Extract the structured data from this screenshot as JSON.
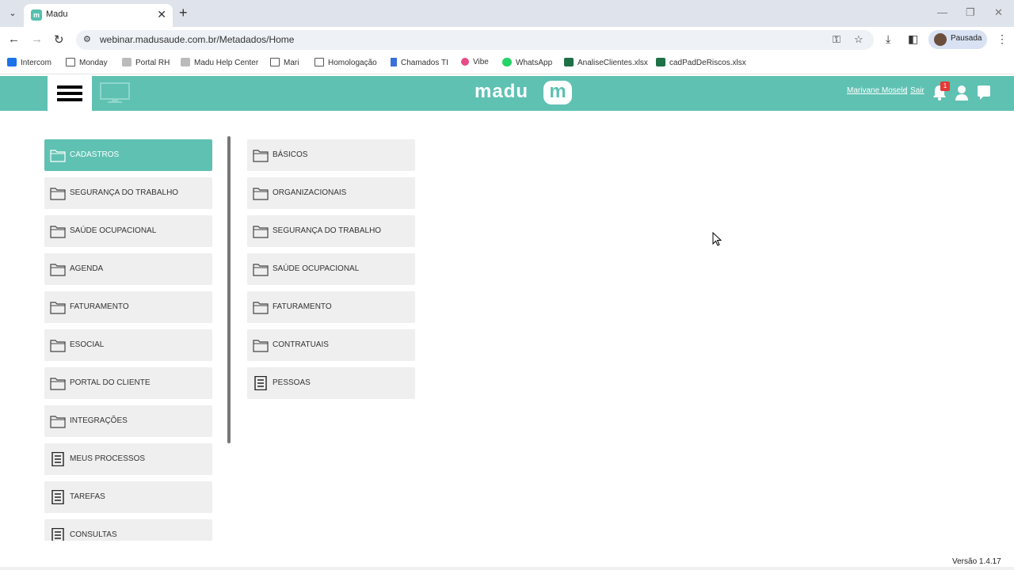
{
  "browser": {
    "tab_title": "Madu",
    "tab_favicon_letter": "m",
    "url": "webinar.madusaude.com.br/Metadados/Home",
    "profile_label": "Pausada",
    "bookmarks": [
      {
        "label": "Intercom",
        "icon": "intercom-icon"
      },
      {
        "label": "Monday",
        "icon": "folder-icon"
      },
      {
        "label": "Portal RH",
        "icon": "portal-icon"
      },
      {
        "label": "Madu Help Center",
        "icon": "help-center-icon"
      },
      {
        "label": "Mari",
        "icon": "folder-icon"
      },
      {
        "label": "Homologação",
        "icon": "folder-icon"
      },
      {
        "label": "Chamados TI",
        "icon": "chamados-icon"
      },
      {
        "label": "Vibe",
        "icon": "vibe-icon"
      },
      {
        "label": "WhatsApp",
        "icon": "whatsapp-icon"
      },
      {
        "label": "AnaliseClientes.xlsx",
        "icon": "excel-icon"
      },
      {
        "label": "cadPadDeRiscos.xlsx",
        "icon": "excel-icon"
      }
    ]
  },
  "header": {
    "logo_text": "madu",
    "logo_mark": "m",
    "user_name": "Marivane Mosele",
    "separator": "|",
    "logout_label": "Sair",
    "notification_count": "1",
    "accent_color": "#5fc1b2"
  },
  "left_menu": [
    {
      "label": "CADASTROS",
      "icon": "folder-icon",
      "active": true
    },
    {
      "label": "SEGURANÇA DO TRABALHO",
      "icon": "folder-icon"
    },
    {
      "label": "SAÚDE OCUPACIONAL",
      "icon": "folder-icon"
    },
    {
      "label": "AGENDA",
      "icon": "folder-icon"
    },
    {
      "label": "FATURAMENTO",
      "icon": "folder-icon"
    },
    {
      "label": "ESOCIAL",
      "icon": "folder-icon"
    },
    {
      "label": "PORTAL DO CLIENTE",
      "icon": "folder-icon"
    },
    {
      "label": "INTEGRAÇÕES",
      "icon": "folder-icon"
    },
    {
      "label": "MEUS PROCESSOS",
      "icon": "document-icon"
    },
    {
      "label": "TAREFAS",
      "icon": "document-icon"
    },
    {
      "label": "CONSULTAS",
      "icon": "document-icon"
    }
  ],
  "sub_menu": [
    {
      "label": "BÁSICOS",
      "icon": "folder-icon"
    },
    {
      "label": "ORGANIZACIONAIS",
      "icon": "folder-icon"
    },
    {
      "label": "SEGURANÇA DO TRABALHO",
      "icon": "folder-icon"
    },
    {
      "label": "SAÚDE OCUPACIONAL",
      "icon": "folder-icon"
    },
    {
      "label": "FATURAMENTO",
      "icon": "folder-icon"
    },
    {
      "label": "CONTRATUAIS",
      "icon": "folder-icon"
    },
    {
      "label": "PESSOAS",
      "icon": "document-icon"
    }
  ],
  "footer": {
    "version": "Versão 1.4.17"
  }
}
